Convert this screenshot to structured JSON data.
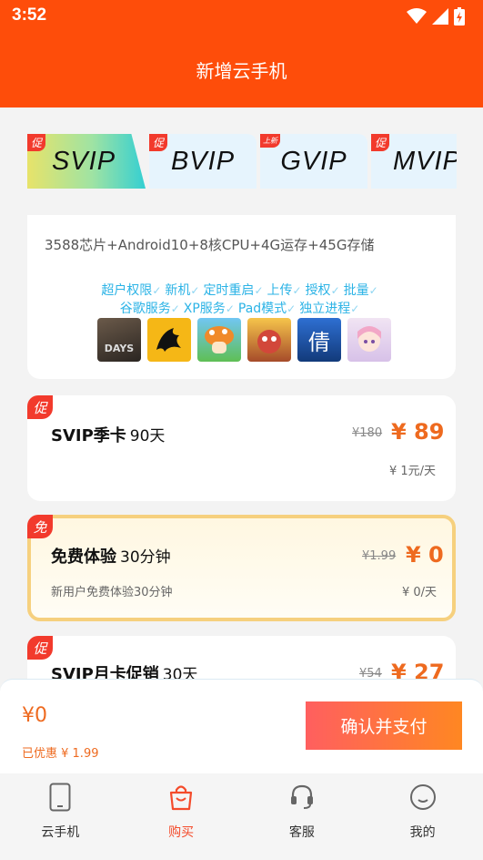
{
  "status_bar": {
    "time": "3:52"
  },
  "header": {
    "title": "新增云手机"
  },
  "tabs": [
    {
      "badge": "促",
      "label": "SVIP",
      "selected": true
    },
    {
      "badge": "促",
      "label": "BVIP"
    },
    {
      "badge": "上新",
      "label": "GVIP"
    },
    {
      "badge": "促",
      "label": "MVIP"
    }
  ],
  "features": {
    "spec": "3588芯片+Android10+8核CPU+4G运存+45G存储",
    "row1": [
      "超户权限",
      "新机",
      "定时重启",
      "上传",
      "授权",
      "批量"
    ],
    "row2": [
      "谷歌服务",
      "XP服务",
      "Pad模式",
      "独立进程"
    ],
    "check_mark": "✓",
    "app_icons": [
      "days-game-icon",
      "dragon-game-icon",
      "mushroom-game-icon",
      "monster-game-icon",
      "qian-game-icon",
      "anime-girl-game-icon"
    ],
    "app_icon_text": {
      "days": "DAYS",
      "qian": "倩"
    }
  },
  "plans": [
    {
      "badge": "促",
      "name": "SVIP季卡",
      "duration": "90天",
      "old_price": "¥180",
      "price": "¥ 89",
      "per_day": "¥ 1元/天"
    },
    {
      "badge": "免",
      "name": "免费体验",
      "duration": "30分钟",
      "old_price": "¥1.99",
      "price": "¥ 0",
      "desc": "新用户免费体验30分钟",
      "per_day": "¥ 0/天"
    },
    {
      "badge": "促",
      "name": "SVIP月卡促销",
      "duration": "30天",
      "old_price": "¥54",
      "price": "¥ 27"
    }
  ],
  "payment": {
    "amount": "¥0",
    "saved": "已优惠 ¥ 1.99",
    "confirm_label": "确认并支付"
  },
  "nav": [
    {
      "label": "云手机",
      "icon": "phone-icon"
    },
    {
      "label": "购买",
      "icon": "shopping-bag-icon",
      "active": true
    },
    {
      "label": "客服",
      "icon": "headset-icon"
    },
    {
      "label": "我的",
      "icon": "smile-face-icon"
    }
  ],
  "colors": {
    "brand": "#fe4d0a",
    "price": "#ee6a1f",
    "badge": "#f23a2c",
    "feature": "#2bb3e6"
  }
}
